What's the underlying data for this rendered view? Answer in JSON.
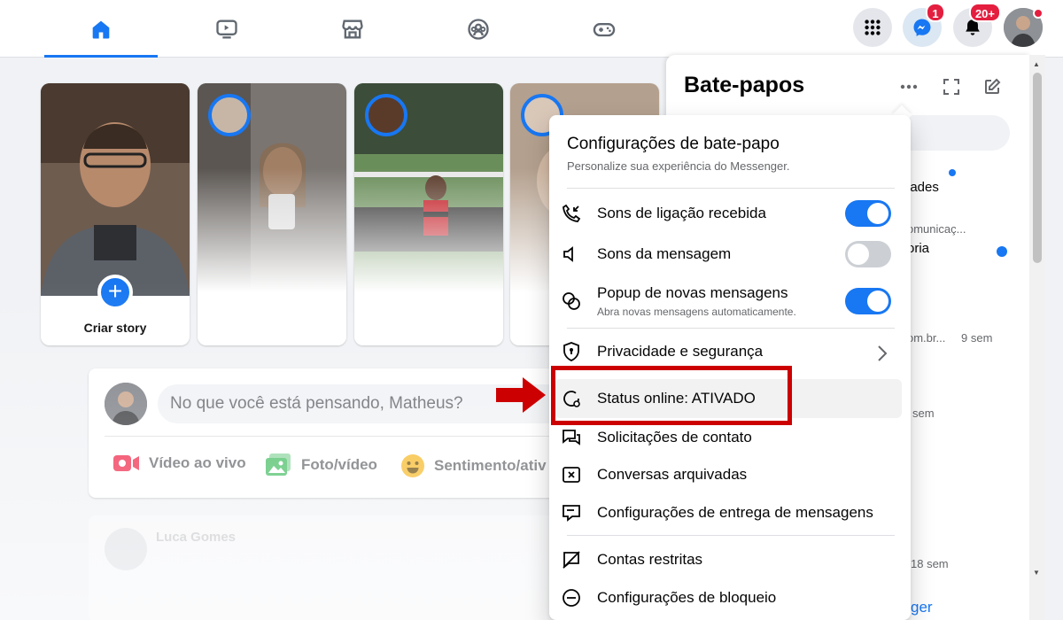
{
  "nav": {
    "tabs": [
      {
        "name": "home-icon",
        "active": true
      },
      {
        "name": "video-icon",
        "active": false
      },
      {
        "name": "marketplace-icon",
        "active": false
      },
      {
        "name": "groups-icon",
        "active": false
      },
      {
        "name": "gaming-icon",
        "active": false
      }
    ],
    "messenger_badge": "1",
    "notifications_badge": "20+"
  },
  "stories": {
    "create_label": "Criar story"
  },
  "composer": {
    "placeholder": "No que você está pensando, Matheus?",
    "actions": {
      "live": "Vídeo ao vivo",
      "photo": "Foto/vídeo",
      "feeling": "Sentimento/ativ"
    }
  },
  "feed": {
    "post_author": "Luca Gomes"
  },
  "chat": {
    "title": "Bate-papos",
    "fragments": {
      "f1": "lades",
      "f2": "omunicaç...",
      "f3": "oria",
      "f4": "om.br...",
      "f4_time": "9 sem",
      "f5_time": "sem",
      "f6_time": "18 sem",
      "f7": "ger"
    }
  },
  "menu": {
    "title": "Configurações de bate-papo",
    "subtitle": "Personalize sua experiência do Messenger.",
    "items": {
      "incoming_call_sounds": "Sons de ligação recebida",
      "message_sounds": "Sons da mensagem",
      "new_message_popup": "Popup de novas mensagens",
      "new_message_popup_desc": "Abra novas mensagens automaticamente.",
      "privacy": "Privacidade e segurança",
      "online_status": "Status online: ATIVADO",
      "contact_requests": "Solicitações de contato",
      "archived": "Conversas arquivadas",
      "delivery_settings": "Configurações de entrega de mensagens",
      "restricted": "Contas restritas",
      "block_settings": "Configurações de bloqueio"
    },
    "toggles": {
      "incoming_call_sounds": true,
      "message_sounds": false,
      "new_message_popup": true
    }
  },
  "colors": {
    "accent": "#1877f2",
    "highlight": "#cc0000"
  }
}
